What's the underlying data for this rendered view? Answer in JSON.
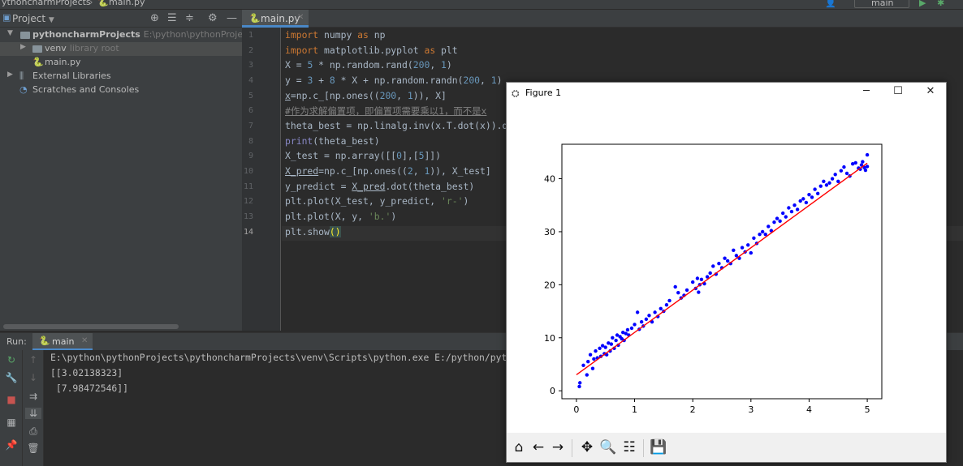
{
  "topbar": {
    "breadcrumb_project": "ythoncharmProjects",
    "breadcrumb_file": "main.py",
    "run_config": "main"
  },
  "project_panel": {
    "title": "Project",
    "tree": [
      {
        "label": "pythoncharmProjects",
        "hint": "E:\\python\\pythonProjects\\py",
        "kind": "project"
      },
      {
        "label": "venv",
        "hint": "library root",
        "kind": "folder"
      },
      {
        "label": "main.py",
        "hint": "",
        "kind": "file"
      },
      {
        "label": "External Libraries",
        "hint": "",
        "kind": "library"
      },
      {
        "label": "Scratches and Consoles",
        "hint": "",
        "kind": "scratch"
      }
    ]
  },
  "editor": {
    "tab_label": "main.py",
    "current_line": 14,
    "line_numbers": [
      "1",
      "2",
      "3",
      "4",
      "5",
      "6",
      "7",
      "8",
      "9",
      "10",
      "11",
      "12",
      "13",
      "14"
    ],
    "lines": [
      "import numpy as np",
      "import matplotlib.pyplot as plt",
      "X = 5 * np.random.rand(200, 1)",
      "y = 3 + 8 * X + np.random.randn(200, 1)",
      "x=np.c_[np.ones((200, 1)), X]",
      "#作为求解偏置项，即偏置项需要乘以1，而不是x",
      "theta_best = np.linalg.inv(x.T.dot(x)).d",
      "print(theta_best)",
      "X_test = np.array([[0],[5]])",
      "X_pred=np.c_[np.ones((2, 1)), X_test]",
      "y_predict = X_pred.dot(theta_best)",
      "plt.plot(X_test, y_predict, 'r-')",
      "plt.plot(X, y, 'b.')",
      "plt.show()"
    ]
  },
  "run_panel": {
    "label": "Run:",
    "tab_label": "main",
    "console": [
      "E:\\python\\pythonProjects\\pythoncharmProjects\\venv\\Scripts\\python.exe E:/python/pyth",
      "[[3.02138323]",
      " [7.98472546]]"
    ]
  },
  "figure": {
    "title": "Figure 1",
    "minimize": "─",
    "maximize": "☐",
    "close": "✕",
    "toolbar_icons": [
      "home-icon",
      "back-icon",
      "forward-icon",
      "pan-icon",
      "zoom-icon",
      "configure-icon",
      "save-icon"
    ]
  },
  "chart_data": {
    "type": "scatter",
    "title": "",
    "xlabel": "",
    "ylabel": "",
    "xlim": [
      -0.25,
      5.25
    ],
    "ylim": [
      -1.5,
      46.5
    ],
    "xticks": [
      "0",
      "1",
      "2",
      "3",
      "4",
      "5"
    ],
    "xtick_values": [
      0,
      1,
      2,
      3,
      4,
      5
    ],
    "yticks": [
      "0",
      "10",
      "20",
      "30",
      "40"
    ],
    "ytick_values": [
      0,
      10,
      20,
      30,
      40
    ],
    "grid": false,
    "series": [
      {
        "style": "b.",
        "color": "#0000ff",
        "x": [
          0.05,
          0.06,
          0.12,
          0.18,
          0.2,
          0.24,
          0.28,
          0.3,
          0.33,
          0.36,
          0.4,
          0.42,
          0.45,
          0.48,
          0.5,
          0.52,
          0.55,
          0.58,
          0.6,
          0.62,
          0.65,
          0.68,
          0.7,
          0.72,
          0.75,
          0.78,
          0.8,
          0.82,
          0.85,
          0.88,
          0.9,
          0.95,
          1.0,
          1.05,
          1.08,
          1.12,
          1.15,
          1.2,
          1.25,
          1.3,
          1.35,
          1.4,
          1.45,
          1.5,
          1.55,
          1.6,
          1.7,
          1.75,
          1.8,
          1.85,
          1.9,
          2.0,
          2.05,
          2.08,
          2.1,
          2.12,
          2.15,
          2.2,
          2.25,
          2.3,
          2.35,
          2.4,
          2.45,
          2.5,
          2.55,
          2.6,
          2.65,
          2.7,
          2.75,
          2.8,
          2.85,
          2.9,
          2.95,
          3.0,
          3.05,
          3.1,
          3.15,
          3.2,
          3.25,
          3.3,
          3.35,
          3.4,
          3.45,
          3.5,
          3.55,
          3.6,
          3.65,
          3.7,
          3.75,
          3.8,
          3.85,
          3.9,
          3.95,
          4.0,
          4.05,
          4.1,
          4.15,
          4.2,
          4.25,
          4.3,
          4.35,
          4.4,
          4.45,
          4.5,
          4.55,
          4.6,
          4.65,
          4.7,
          4.75,
          4.8,
          4.85,
          4.88,
          4.9,
          4.92,
          4.95,
          4.97,
          5.0,
          5.0
        ],
        "y": [
          0.8,
          1.5,
          4.8,
          3.0,
          5.5,
          6.8,
          4.2,
          6.0,
          7.5,
          6.2,
          8.0,
          6.5,
          8.5,
          7.0,
          8.2,
          6.8,
          9.0,
          7.5,
          8.8,
          10.0,
          8.0,
          9.5,
          10.5,
          8.6,
          10.2,
          9.8,
          11.0,
          9.5,
          10.8,
          11.5,
          10.5,
          11.8,
          12.5,
          14.8,
          11.6,
          13.0,
          12.2,
          13.5,
          14.2,
          13.0,
          14.8,
          14.0,
          15.5,
          15.0,
          16.2,
          17.0,
          19.6,
          18.5,
          17.5,
          18.0,
          19.0,
          20.5,
          19.3,
          21.2,
          18.6,
          20.0,
          21.0,
          20.2,
          21.5,
          22.2,
          23.5,
          22.0,
          24.0,
          23.2,
          25.0,
          24.5,
          24.0,
          26.5,
          25.5,
          25.0,
          27.0,
          26.2,
          27.5,
          26.0,
          28.8,
          27.8,
          29.5,
          30.0,
          29.5,
          31.0,
          30.2,
          31.8,
          32.5,
          32.0,
          33.5,
          32.8,
          34.5,
          33.8,
          35.0,
          34.2,
          35.8,
          36.2,
          35.5,
          37.0,
          36.5,
          38.0,
          37.2,
          38.6,
          39.5,
          38.8,
          39.2,
          40.0,
          40.8,
          39.5,
          41.5,
          42.2,
          41.0,
          40.5,
          42.8,
          43.0,
          42.0,
          41.8,
          42.6,
          43.2,
          42.1,
          41.6,
          44.5,
          42.3
        ]
      },
      {
        "style": "r-",
        "color": "#ff0000",
        "x": [
          0,
          5
        ],
        "y": [
          3.02138323,
          42.94500053
        ]
      }
    ]
  }
}
